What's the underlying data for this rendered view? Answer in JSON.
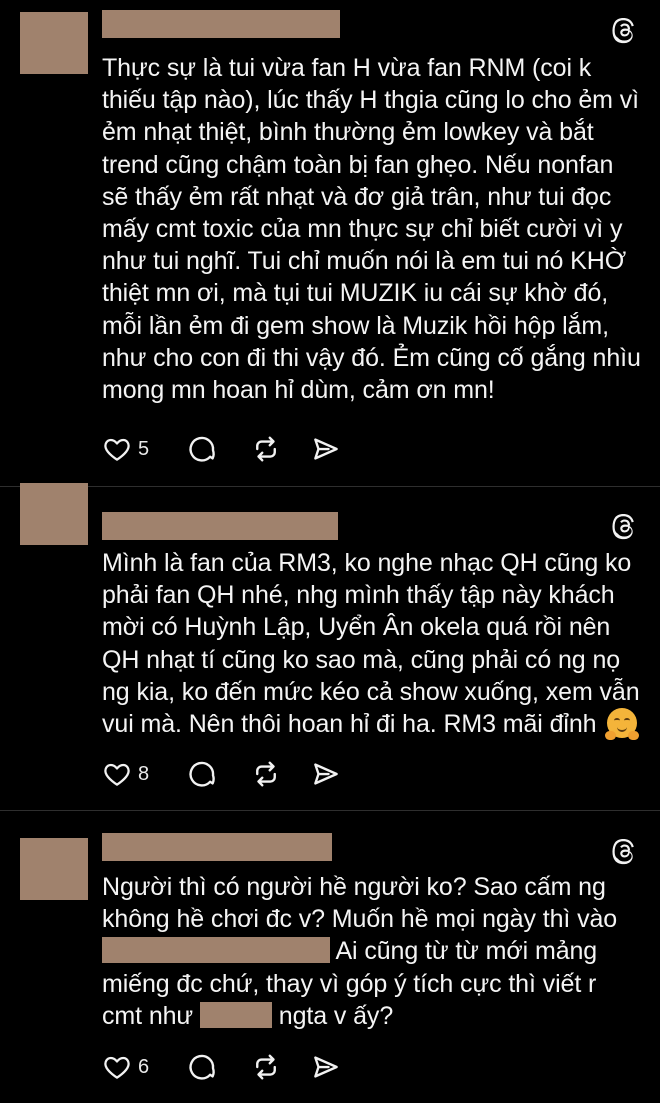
{
  "colors": {
    "background": "#000000",
    "text": "#f3f3f3",
    "redaction": "#a0826d",
    "divider": "#2e2e2e"
  },
  "posts": [
    {
      "body": "Thực sự là tui vừa fan H vừa fan RNM (coi k thiếu tập nào), lúc thấy H thgia cũng lo cho ẻm vì ẻm nhạt thiệt, bình thường ẻm lowkey và bắt trend cũng chậm toàn bị fan ghẹo. Nếu nonfan sẽ thấy ẻm rất nhạt và đơ giả trân, như tui đọc mấy cmt toxic của mn thực sự chỉ biết cười vì y như tui nghĩ. Tui chỉ muốn nói là em tui nó KHỜ thiệt mn ơi, mà tụi tui MUZIK iu cái sự khờ đó, mỗi lần ẻm đi gem show là Muzik hồi hộp lắm, như cho con đi thi vậy đó. Ẻm cũng cố gắng nhìu mong mn hoan hỉ dùm, cảm ơn mn!",
      "likes": "5",
      "icons": [
        "heart-icon",
        "comment-icon",
        "repost-icon",
        "share-icon",
        "threads-logo-icon"
      ]
    },
    {
      "body": "Mình là fan của RM3, ko nghe nhạc QH cũng ko phải fan QH nhé, nhg mình thấy tập này khách mời có Huỳnh Lập, Uyển Ân okela quá rồi nên QH nhạt tí cũng ko sao mà, cũng phải có ng nọ ng kia, ko đến mức kéo cả show xuống, xem vẫn vui mà. Nên thôi hoan hỉ đi ha. RM3 mãi đỉnh",
      "emoji": "hugging-face",
      "likes": "8",
      "icons": [
        "heart-icon",
        "comment-icon",
        "repost-icon",
        "share-icon",
        "threads-logo-icon"
      ]
    },
    {
      "body_part1": "Người thì có người hề người ko? Sao cấm ng không hề chơi đc v? Muốn hề mọi ngày thì vào",
      "body_part2": "Ai cũng từ từ mới mảng miếng đc chứ, thay vì góp ý tích cực thì viết r cmt như",
      "body_part3": "ngta v ấy?",
      "likes": "6",
      "icons": [
        "heart-icon",
        "comment-icon",
        "repost-icon",
        "share-icon",
        "threads-logo-icon"
      ]
    }
  ]
}
